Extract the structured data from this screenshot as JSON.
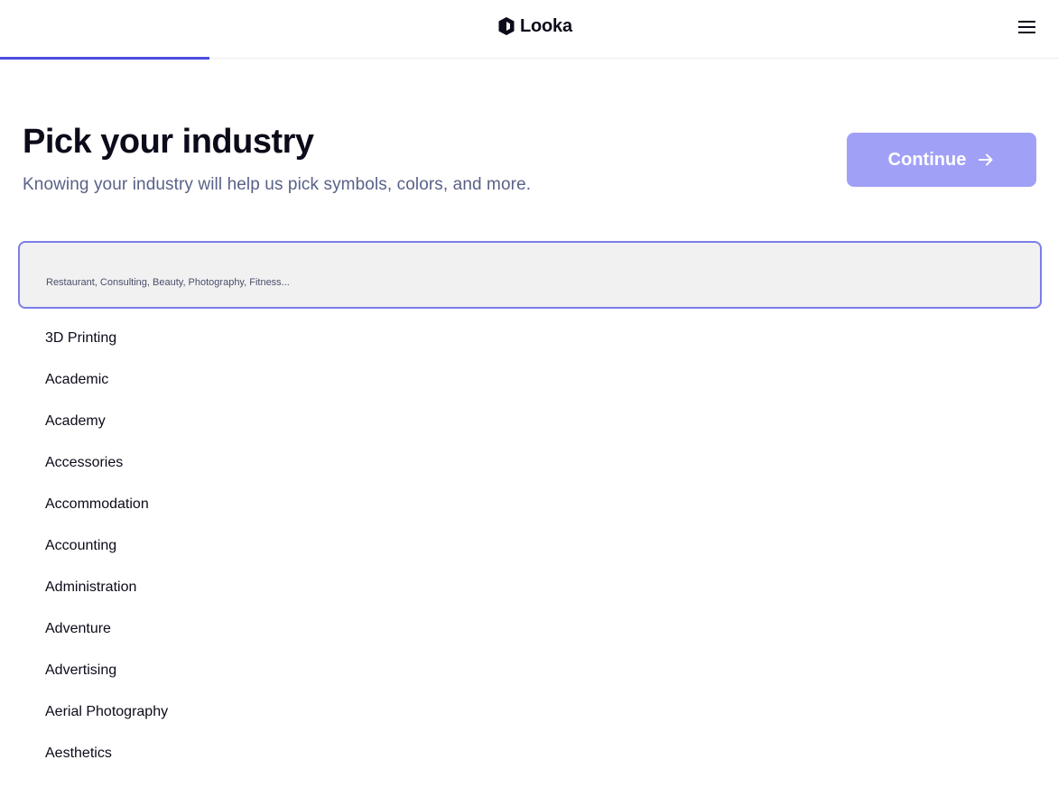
{
  "header": {
    "brand": "Looka",
    "logo_icon": "looka-logo-icon",
    "menu_icon": "hamburger-menu-icon"
  },
  "progress": {
    "fraction": 0.198,
    "color": "#4b4ee0"
  },
  "main": {
    "title": "Pick your industry",
    "subtitle": "Knowing your industry will help us pick symbols, colors, and more.",
    "continue_label": "Continue",
    "continue_icon": "arrow-right-icon",
    "accent_color": "#a1a0f7"
  },
  "search": {
    "value": "",
    "placeholder": "Restaurant, Consulting, Beauty, Photography, Fitness..."
  },
  "industries": [
    "3D Printing",
    "Academic",
    "Academy",
    "Accessories",
    "Accommodation",
    "Accounting",
    "Administration",
    "Adventure",
    "Advertising",
    "Aerial Photography",
    "Aesthetics"
  ]
}
